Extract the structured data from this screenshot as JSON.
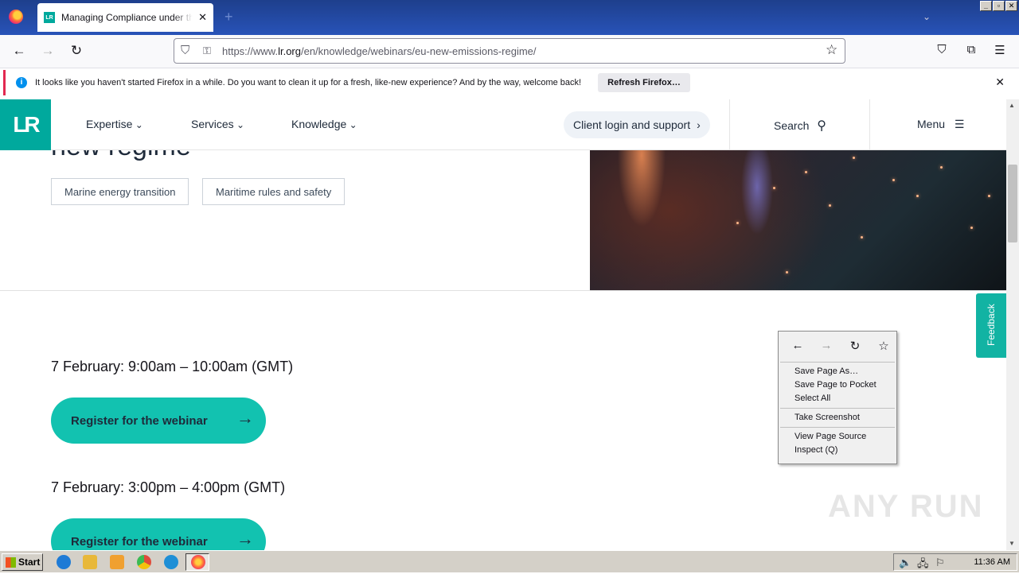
{
  "browser": {
    "tab_title": "Managing Compliance under the EU",
    "tab_favicon": "LR",
    "new_tab_icon": "+",
    "url_domain": "lr.org",
    "url_prefix": "https://www.",
    "url_path": "/en/knowledge/webinars/eu-new-emissions-regime/",
    "icons": {
      "back": "←",
      "forward": "→",
      "reload": "↻",
      "shield": "⛉",
      "lock": "🔒",
      "bookmark": "☆",
      "pocket": "⛉",
      "extensions": "⧉",
      "menu": "☰"
    },
    "window_buttons": [
      "_",
      "▫",
      "✕"
    ],
    "notice_icon": "i",
    "notice_text": "It looks like you haven't started Firefox in a while. Do you want to clean it up for a fresh, like-new experience? And by the way, welcome back!",
    "notice_button": "Refresh Firefox…",
    "close_glyph": "✕"
  },
  "site": {
    "logo": "LR",
    "nav": [
      "Expertise",
      "Services",
      "Knowledge"
    ],
    "client_button": "Client login and support",
    "client_button_chevron": "›",
    "search_label": "Search",
    "search_icon": "⚲",
    "menu_label": "Menu",
    "menu_icon": "☰",
    "title_fragment": "new regime",
    "tags": [
      "Marine energy transition",
      "Maritime rules and safety"
    ],
    "sessions": [
      {
        "time": "7 February: 9:00am – 10:00am (GMT)",
        "button": "Register for the webinar"
      },
      {
        "time": "7 February: 3:00pm – 4:00pm (GMT)",
        "button": "Register for the webinar"
      }
    ],
    "arrow_glyph": "→",
    "feedback": "Feedback",
    "watermark": "ANY RUN"
  },
  "context_menu": {
    "icons": [
      "←",
      "→",
      "↻",
      "☆"
    ],
    "items_group1": [
      "Save Page As…",
      "Save Page to Pocket",
      "Select All"
    ],
    "items_group2": [
      "Take Screenshot"
    ],
    "items_group3": [
      "View Page Source",
      "Inspect (Q)"
    ]
  },
  "taskbar": {
    "start": "Start",
    "clock": "11:36 AM",
    "colors": {
      "ie": "#1e7bd6",
      "explorer": "#e8b83a",
      "media": "#f0a030",
      "chrome": "#e04b3a",
      "edge": "#1e8fd6",
      "firefox": "#ff7139"
    }
  }
}
